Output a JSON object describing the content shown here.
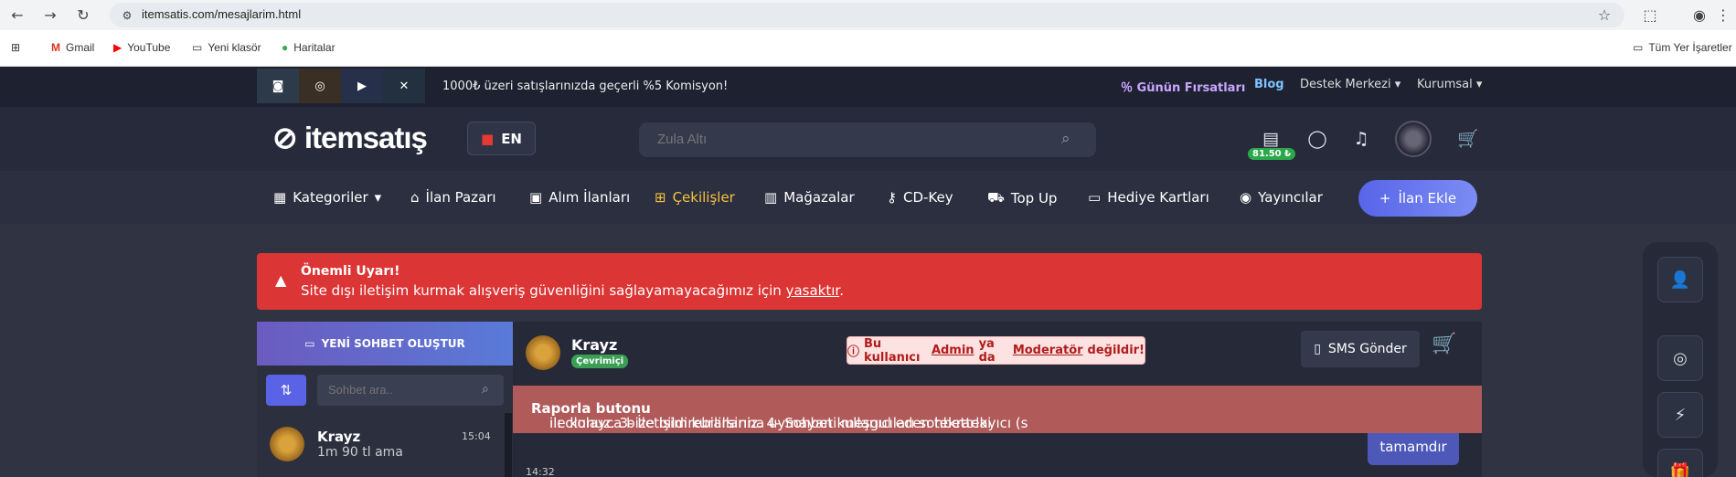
{
  "browser": {
    "url": "itemsatis.com/mesajlarim.html",
    "bookmarks": [
      "Gmail",
      "YouTube",
      "Yeni klasör",
      "Haritalar"
    ],
    "bookmarks_right": "Tüm Yer İşaretler"
  },
  "topbar": {
    "promo": "1000₺ üzeri satışlarınızda geçerli %5 Komisyon!",
    "links": [
      "Günün Fırsatları",
      "Blog",
      "Destek Merkezi",
      "Kurumsal"
    ]
  },
  "header": {
    "logo": "itemsatış",
    "lang": "EN",
    "search_placeholder": "Zula Altı",
    "balance": "81.50 ₺"
  },
  "menu": {
    "items": [
      "Kategoriler",
      "İlan Pazarı",
      "Alım İlanları",
      "Çekilişler",
      "Mağazalar",
      "CD-Key",
      "Top Up",
      "Hediye Kartları",
      "Yayıncılar"
    ],
    "add_button": "İlan Ekle"
  },
  "alert": {
    "title": "Önemli Uyarı!",
    "text": "Site dışı iletişim kurmak alışveriş güvenliğini sağlayamayacağımız için",
    "link": "yasaktır",
    "end": "."
  },
  "chat": {
    "new_chat_button": "YENİ SOHBET OLUŞTUR",
    "search_placeholder": "Sohbet ara..",
    "contact": {
      "name": "Krayz",
      "message": "1m 90 tl ama",
      "time": "15:04"
    },
    "user": {
      "name": "Krayz",
      "status": "Çevrimiçi"
    },
    "warning": {
      "pre": "Bu kullanıcı",
      "admin": "Admin",
      "mid": "ya da",
      "mod": "Moderatör",
      "post": "değildir!"
    },
    "sms_button": "SMS Gönder",
    "marquee_pre": "ılı olunuz. 3- İletişim kurallarına uymayan kullanıcıları sohbetteki",
    "marquee_bold": "Raporla butonu",
    "marquee_post": "ile kolayca bize bildirebilirsiniz. 4- Sohbeti meşgul eden tekrarlayıcı (s",
    "bubble": "tamamdır",
    "message_time": "14:32"
  }
}
